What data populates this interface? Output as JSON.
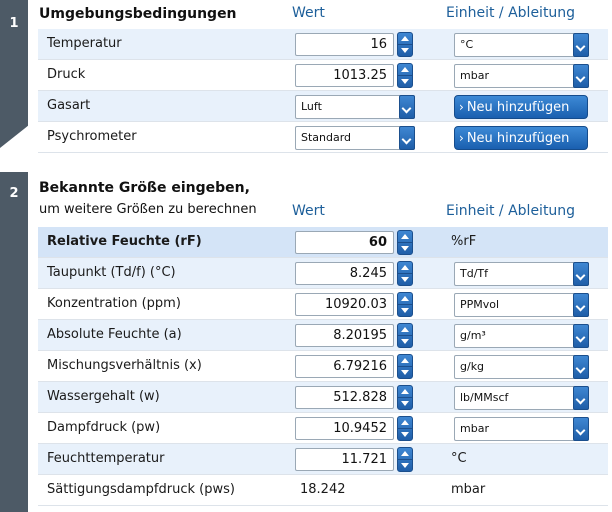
{
  "section1": {
    "number": "1",
    "title": "Umgebungsbedingungen",
    "col_value": "Wert",
    "col_unit": "Einheit / Ableitung",
    "rows": {
      "temperatur": {
        "label": "Temperatur",
        "value": "16",
        "unit": "°C"
      },
      "druck": {
        "label": "Druck",
        "value": "1013.25",
        "unit": "mbar"
      },
      "gasart": {
        "label": "Gasart",
        "value": "Luft",
        "button": "Neu hinzufügen"
      },
      "psychrometer": {
        "label": "Psychrometer",
        "value": "Standard",
        "button": "Neu hinzufügen"
      }
    }
  },
  "section2": {
    "number": "2",
    "title": "Bekannte Größe eingeben,",
    "subtitle": "um weitere Größen zu berechnen",
    "col_value": "Wert",
    "col_unit": "Einheit / Ableitung",
    "rows": {
      "rf": {
        "label": "Relative Feuchte (rF)",
        "value": "60",
        "unit": "%rF"
      },
      "taupunkt": {
        "label": "Taupunkt (Td/f) (°C)",
        "value": "8.245",
        "unit": "Td/Tf"
      },
      "konzentration": {
        "label": "Konzentration (ppm)",
        "value": "10920.03",
        "unit": "PPMvol"
      },
      "absolut": {
        "label": "Absolute Feuchte (a)",
        "value": "8.20195",
        "unit": "g/m³"
      },
      "mischung": {
        "label": "Mischungsverhältnis (x)",
        "value": "6.79216",
        "unit": "g/kg"
      },
      "wasser": {
        "label": "Wassergehalt (w)",
        "value": "512.828",
        "unit": "lb/MMscf"
      },
      "dampf": {
        "label": "Dampfdruck (pw)",
        "value": "10.9452",
        "unit": "mbar"
      },
      "feucht": {
        "label": "Feuchttemperatur",
        "value": "11.721",
        "unit": "°C"
      },
      "saett": {
        "label": "Sättigungsdampfdruck (pws)",
        "value": "18.242",
        "unit": "mbar"
      }
    }
  }
}
